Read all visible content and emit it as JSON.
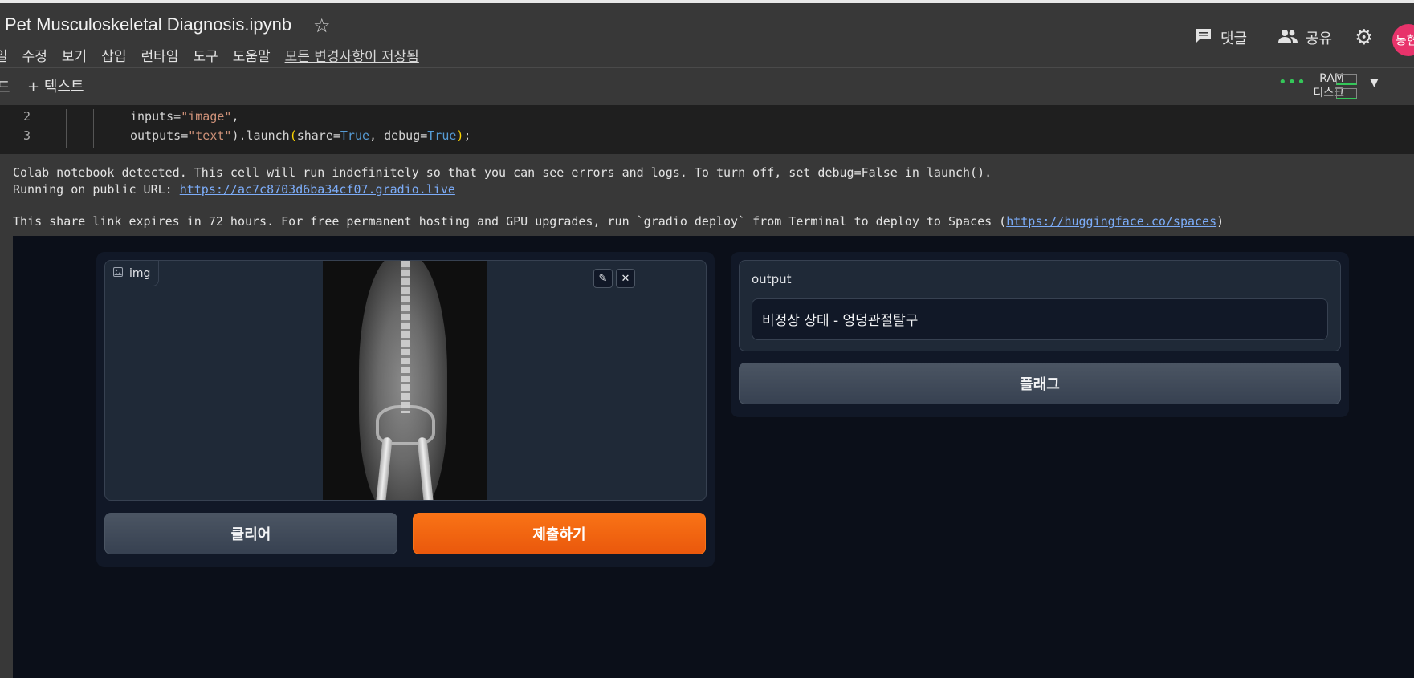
{
  "header": {
    "title": "Pet Musculoskeletal Diagnosis.ipynb",
    "menu": [
      "일",
      "수정",
      "보기",
      "삽입",
      "런타임",
      "도구",
      "도움말"
    ],
    "saved_status": "모든 변경사항이 저장됨",
    "comment_label": "댓글",
    "share_label": "공유",
    "avatar_text": "동현"
  },
  "toolbar": {
    "code_fragment": "드",
    "add_text_label": "텍스트",
    "ram_label": "RAM",
    "disk_label": "디스크"
  },
  "code": {
    "lines": [
      {
        "number": "2",
        "parts": [
          {
            "t": "inputs="
          },
          {
            "t": "\"image\"",
            "c": "str"
          },
          {
            "t": ","
          }
        ]
      },
      {
        "number": "3",
        "parts": [
          {
            "t": "outputs="
          },
          {
            "t": "\"text\"",
            "c": "str"
          },
          {
            "t": ").launch"
          },
          {
            "t": "(",
            "c": "br"
          },
          {
            "t": "share="
          },
          {
            "t": "True",
            "c": "kw"
          },
          {
            "t": ", debug="
          },
          {
            "t": "True",
            "c": "kw"
          },
          {
            "t": ")",
            "c": "br"
          },
          {
            "t": ";"
          }
        ]
      }
    ]
  },
  "output": {
    "line1": "Colab notebook detected. This cell will run indefinitely so that you can see errors and logs. To turn off, set debug=False in launch().",
    "line2_prefix": "Running on public URL: ",
    "public_url": "https://ac7c8703d6ba34cf07.gradio.live",
    "line3_prefix": "This share link expires in 72 hours. For free permanent hosting and GPU upgrades, run `gradio deploy` from Terminal to deploy to Spaces (",
    "spaces_url": "https://huggingface.co/spaces",
    "line3_suffix": ")"
  },
  "gradio": {
    "image_label": "img",
    "clear_label": "클리어",
    "submit_label": "제출하기",
    "output_label": "output",
    "output_value": "비정상 상태 - 엉덩관절탈구",
    "flag_label": "플래그"
  }
}
